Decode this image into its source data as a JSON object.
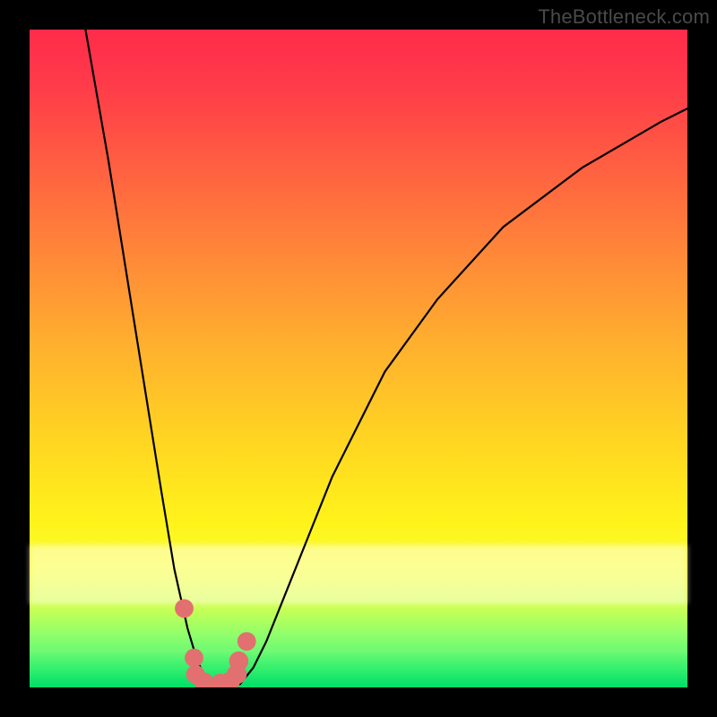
{
  "watermark": "TheBottleneck.com",
  "chart_data": {
    "type": "line",
    "title": "",
    "xlabel": "",
    "ylabel": "",
    "xlim": [
      0,
      100
    ],
    "ylim": [
      0,
      100
    ],
    "grid": false,
    "series": [
      {
        "name": "bottleneck-curve",
        "x": [
          8.5,
          12,
          16,
          20,
          22,
          24,
          25.5,
          27,
          28.5,
          30,
          32,
          34,
          36,
          40,
          46,
          54,
          62,
          72,
          84,
          96,
          100
        ],
        "values": [
          100,
          80,
          55,
          30,
          18,
          9,
          4,
          1,
          0,
          0,
          0.5,
          3,
          7,
          17,
          32,
          48,
          59,
          70,
          79,
          86,
          88
        ]
      }
    ],
    "markers": [
      {
        "x": 23.5,
        "y": 12,
        "r": 1.2
      },
      {
        "x": 25.0,
        "y": 4.5,
        "r": 1.2
      },
      {
        "x": 25.2,
        "y": 2.0,
        "r": 1.2
      },
      {
        "x": 26.5,
        "y": 0.8,
        "r": 1.3
      },
      {
        "x": 29.0,
        "y": 0.6,
        "r": 1.3
      },
      {
        "x": 30.5,
        "y": 0.9,
        "r": 1.3
      },
      {
        "x": 31.5,
        "y": 2.0,
        "r": 1.4
      },
      {
        "x": 31.8,
        "y": 4.0,
        "r": 1.3
      },
      {
        "x": 33.0,
        "y": 7.0,
        "r": 1.2
      }
    ],
    "colors": {
      "curve": "#000000",
      "markers": "#e27070",
      "gradient_top": "#ff2b4a",
      "gradient_bottom": "#00e06a"
    }
  }
}
